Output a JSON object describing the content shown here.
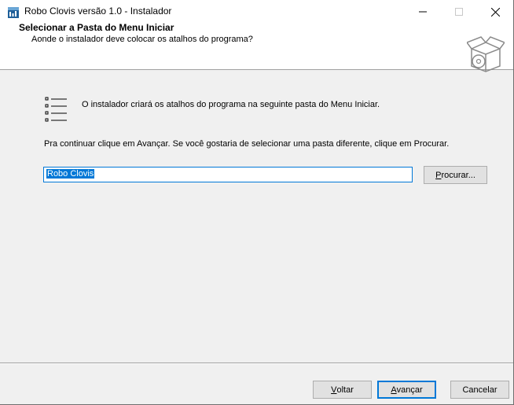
{
  "window": {
    "title": "Robo Clovis versão 1.0 - Instalador",
    "app_icon": "installer-app-icon",
    "controls": {
      "minimize_icon": "minimize-icon",
      "maximize_icon": "maximize-icon",
      "close_icon": "close-icon"
    }
  },
  "header": {
    "title": "Selecionar a Pasta do Menu Iniciar",
    "subtitle": "Aonde o instalador deve colocar os atalhos do programa?",
    "graphic_icon": "software-box-cd-icon"
  },
  "body": {
    "list_icon": "start-menu-list-icon",
    "info_text": "O instalador criará os atalhos do programa na seguinte pasta do Menu Iniciar.",
    "instruction_text": "Pra continuar clique em Avançar. Se você gostaria de selecionar uma pasta diferente, clique em Procurar.",
    "folder_value": "Robo Clovis",
    "browse_label_accel": "P",
    "browse_label_rest": "rocurar..."
  },
  "footer": {
    "back_accel": "V",
    "back_rest": "oltar",
    "next_accel": "A",
    "next_rest": "vançar",
    "cancel_label": "Cancelar"
  },
  "colors": {
    "accent": "#0078d7",
    "window_bg": "#f0f0f0",
    "header_bg": "#ffffff"
  }
}
